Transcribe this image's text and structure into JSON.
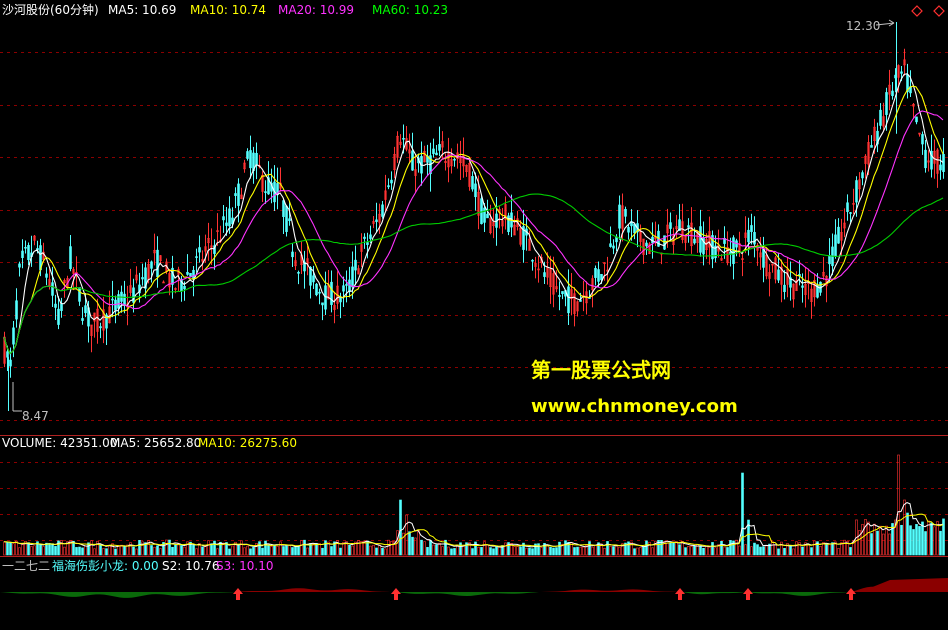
{
  "header": {
    "stock_name": "沙河股份(60分钟)",
    "ma5_label": "MA5: 10.69",
    "ma10_label": "MA10: 10.74",
    "ma20_label": "MA20: 10.99",
    "ma60_label": "MA60: 10.23"
  },
  "price_panel": {
    "high_label": "12.30",
    "low_label": "8.47",
    "high_value": 12.3,
    "low_value": 8.47
  },
  "watermark": {
    "line1": "第一股票公式网",
    "line2": "www.chnmoney.com"
  },
  "volume_panel": {
    "volume_label": "VOLUME: 42351.00",
    "ma5_label": "MA5: 25652.80",
    "ma10_label": "MA10: 26275.60"
  },
  "indicator_panel": {
    "prefix": "一二七二",
    "name_label": "福海伤彭小龙: 0.00",
    "s2_label": "S2: 10.76",
    "s3_label": "S3: 10.10",
    "signal_count": 6
  },
  "colors": {
    "background": "#000000",
    "grid": "#8b0000",
    "up": "#ff3333",
    "down": "#54ffff",
    "ma5": "#ffffff",
    "ma10": "#ffff00",
    "ma20": "#ff33ff",
    "ma60": "#00cc00",
    "watermark": "#ffff00",
    "indicator_green": "#0a6a0a",
    "indicator_red": "#8b0000",
    "signal_arrow": "#ff3030",
    "axis_text": "#c0c0c0"
  },
  "icons": {
    "top_right": "diamond-icons",
    "signal": "up-arrow-icon"
  }
}
